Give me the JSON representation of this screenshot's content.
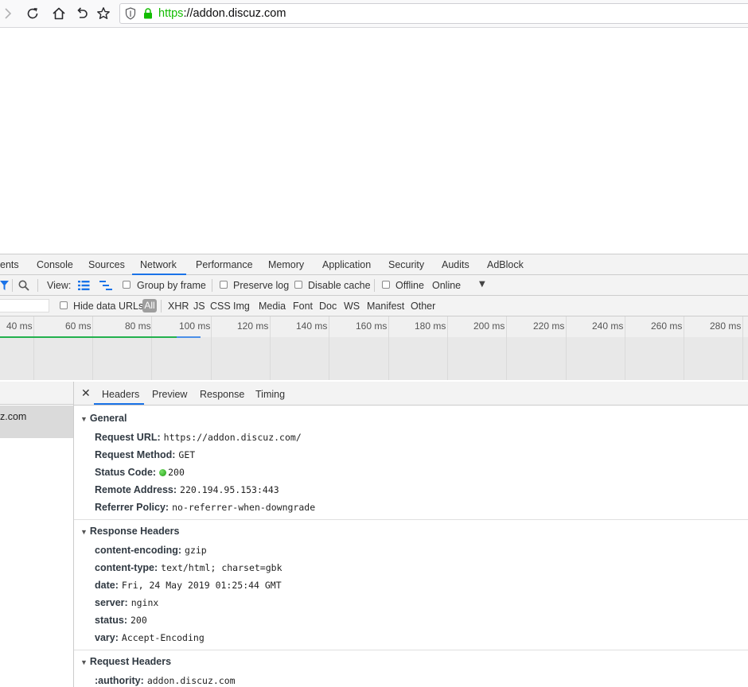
{
  "browser": {
    "url_scheme": "https",
    "url_rest": "://addon.discuz.com"
  },
  "devtools": {
    "tabs": [
      "ents",
      "Console",
      "Sources",
      "Network",
      "Performance",
      "Memory",
      "Application",
      "Security",
      "Audits",
      "AdBlock"
    ],
    "active_tab": "Network",
    "toolbar": {
      "view_label": "View:",
      "group_by_frame": "Group by frame",
      "preserve_log": "Preserve log",
      "disable_cache": "Disable cache",
      "offline": "Offline",
      "throttling": "Online"
    },
    "filter": {
      "hide_data_urls": "Hide data URLs",
      "all": "All",
      "types": [
        "XHR",
        "JS",
        "CSS",
        "Img",
        "Media",
        "Font",
        "Doc",
        "WS",
        "Manifest",
        "Other"
      ]
    },
    "timeline": {
      "ticks": [
        "40 ms",
        "60 ms",
        "80 ms",
        "100 ms",
        "120 ms",
        "140 ms",
        "160 ms",
        "180 ms",
        "200 ms",
        "220 ms",
        "240 ms",
        "260 ms",
        "280 ms"
      ]
    },
    "requests": [
      {
        "name": "z.com"
      }
    ],
    "detail_tabs": [
      "Headers",
      "Preview",
      "Response",
      "Timing"
    ],
    "active_detail_tab": "Headers",
    "general": {
      "title": "General",
      "rows": [
        {
          "name": "Request URL:",
          "value": "https://addon.discuz.com/"
        },
        {
          "name": "Request Method:",
          "value": "GET"
        },
        {
          "name": "Status Code:",
          "value": "200"
        },
        {
          "name": "Remote Address:",
          "value": "220.194.95.153:443"
        },
        {
          "name": "Referrer Policy:",
          "value": "no-referrer-when-downgrade"
        }
      ]
    },
    "response_headers": {
      "title": "Response Headers",
      "rows": [
        {
          "name": "content-encoding:",
          "value": "gzip"
        },
        {
          "name": "content-type:",
          "value": "text/html; charset=gbk"
        },
        {
          "name": "date:",
          "value": "Fri, 24 May 2019 01:25:44 GMT"
        },
        {
          "name": "server:",
          "value": "nginx"
        },
        {
          "name": "status:",
          "value": "200"
        },
        {
          "name": "vary:",
          "value": "Accept-Encoding"
        }
      ]
    },
    "request_headers": {
      "title": "Request Headers",
      "rows": [
        {
          "name": ":authority:",
          "value": "addon.discuz.com"
        }
      ]
    }
  }
}
